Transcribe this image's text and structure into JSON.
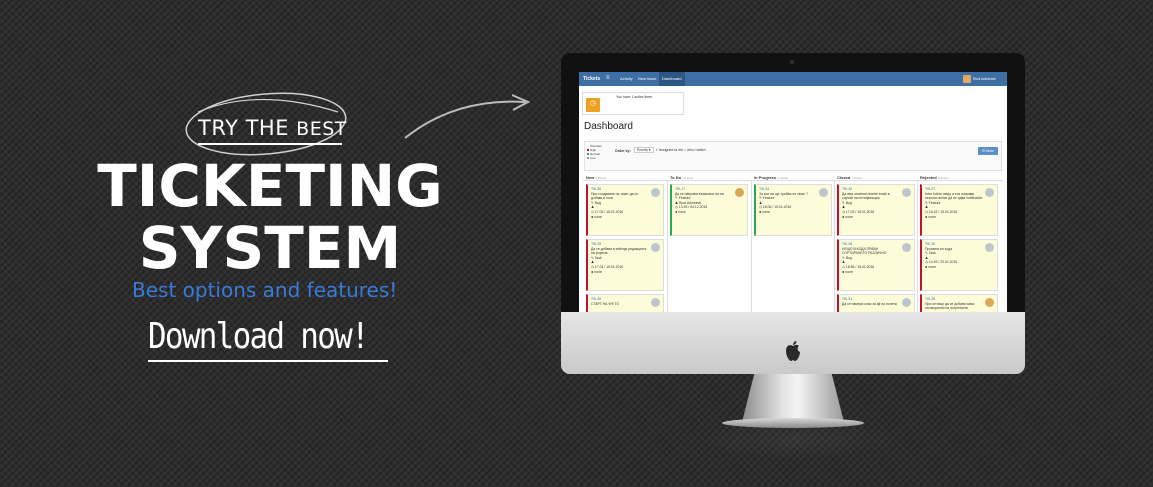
{
  "promo": {
    "try_the": "TRY THE",
    "best": "BEST",
    "title_line1": "TICKETING",
    "title_line2": "SYSTEM",
    "subtitle": "Best options and features!",
    "download": "Download now!"
  },
  "screen": {
    "nav": {
      "brand": "Tickets",
      "menu_icon": "hamburger-icon",
      "tabs": [
        "Activity",
        "New issue",
        "Dashboard"
      ],
      "active_tab": "Dashboard",
      "user": "Root Administr"
    },
    "timer": {
      "text": "You have 1 active timer",
      "button_icon": "timer-icon"
    },
    "page_title": "Dashboard",
    "filters": {
      "priorities_label": "Priorities",
      "priorities": [
        {
          "name": "High",
          "color": "#c8102e"
        },
        {
          "name": "Normal",
          "color": "#2ea84f"
        },
        {
          "name": "Low",
          "color": "#999999"
        }
      ],
      "order_by_label": "Order by:",
      "order_by_value": "Priority ▾",
      "assigned_to_me": "Assigned to me",
      "who_i_watch": "who I watch",
      "more_button": "☰ More"
    },
    "columns": [
      {
        "name": "New",
        "count": "5 issues"
      },
      {
        "name": "To Do",
        "count": "1 issues"
      },
      {
        "name": "In Progress",
        "count": "1 issues"
      },
      {
        "name": "Closed",
        "count": "1 issues"
      },
      {
        "name": "Rejected",
        "count": "3 issues"
      }
    ],
    "cards": {
      "new": [
        {
          "id": "TIK-36",
          "text": "При създаване на тикет да се добавя в лога",
          "type": "Bug",
          "person": "",
          "dates": "17.02 / 15.01.2016",
          "time": "none"
        },
        {
          "id": "TIK-35",
          "text": "Да се добави в settings редакцията на projects",
          "type": "Task",
          "person": "",
          "dates": "17.04 / 15.01.2016",
          "time": "none"
        },
        {
          "id": "TIK-30",
          "text": "СТАРТ НА ФФ ТО",
          "type": "",
          "person": "",
          "dates": "",
          "time": ""
        }
      ],
      "todo": [
        {
          "id": "TIK-17",
          "text": "Да се направи възможно на на",
          "type": "Feature",
          "person": "Root Administr",
          "dates": "13.49 / 04.12.2015",
          "time": "none"
        }
      ],
      "inprogress": [
        {
          "id": "TIK-34",
          "text": "За кое ли ще трябва ли close ?",
          "type": "Feature",
          "person": "",
          "dates": "18.06 / 15.01.2016",
          "time": "none"
        }
      ],
      "closed": [
        {
          "id": "TIK-30",
          "text": "Да има отметка rewrite email в случай на нотификация",
          "type": "Bug",
          "person": "",
          "dates": "17.02 / 15.01.2016",
          "time": "none"
        },
        {
          "id": "TIK-28",
          "text": "НЕЩО В КОДА ПРАВИ СОРТИРАНЕТО РАЗЛИЧНО",
          "type": "Bug",
          "person": "",
          "dates": "18.56 / 15.01.2016",
          "time": "none"
        },
        {
          "id": "TIK-31",
          "text": "Да се намери клас за ajf на полета",
          "type": "",
          "person": "",
          "dates": "",
          "time": ""
        }
      ],
      "rejected": [
        {
          "id": "TIK-27",
          "text": "Като follow нещо и тоя направи неколко active да не идва notification",
          "type": "Feature",
          "person": "",
          "dates": "16.42 / 15.01.2016",
          "time": "none"
        },
        {
          "id": "TIK-26",
          "text": "Промени по кода",
          "type": "Task",
          "person": "",
          "dates": "14.49 / 20.01.2015",
          "time": "none"
        },
        {
          "id": "TIK-26",
          "text": "При отговор да се добави само отговорилия на потребител",
          "type": "",
          "person": "",
          "dates": "",
          "time": ""
        }
      ]
    }
  },
  "colors": {
    "accent_blue": "#3a7bd5",
    "nav_blue": "#3d6fa5",
    "card_yellow": "#fdfcd9"
  }
}
